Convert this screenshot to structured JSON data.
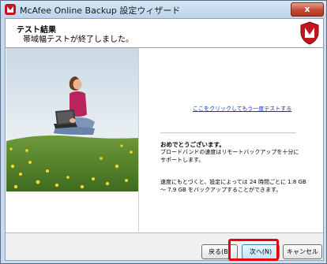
{
  "window": {
    "title": "McAfee Online Backup 設定ウィザード",
    "close_label": "x"
  },
  "header": {
    "title": "テスト結果",
    "subtitle": "帯域幅テストが終了しました。"
  },
  "content": {
    "retest_link": "ここをクリックしてもう一度テストする",
    "congrats": "おめでとうございます。",
    "paragraph1": "ブロードバンドの速度はリモートバックアップを十分にサポートします。",
    "paragraph2": "速度にもとづくと、設定によっては 24 時間ごとに 1.8 GB ～ 7.9 GB をバックアップすることができます。"
  },
  "footer": {
    "back_label": "戻る(B)",
    "next_label": "次へ(N)",
    "cancel_label": "キャンセル"
  },
  "colors": {
    "accent": "#c0171f",
    "link": "#1d2fd0",
    "highlight": "#e60012"
  },
  "icons": {
    "app": "mcafee-shield-icon",
    "header": "mcafee-shield-icon"
  }
}
